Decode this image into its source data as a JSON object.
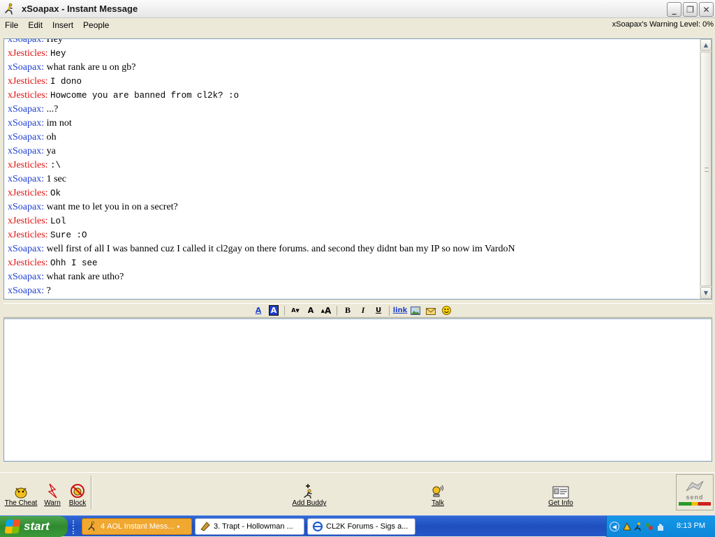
{
  "window": {
    "title": "xSoapax - Instant Message",
    "controls": {
      "minimize": "_",
      "restore": "❐",
      "close": "✕"
    }
  },
  "menubar": {
    "items": [
      "File",
      "Edit",
      "Insert",
      "People"
    ],
    "warning_level": "xSoapax's Warning Level: 0%"
  },
  "conversation": [
    {
      "sn": "xSoapax",
      "color": "blue",
      "text": "Hey"
    },
    {
      "sn": "xJesticles",
      "color": "red",
      "text": "Hey"
    },
    {
      "sn": "xSoapax",
      "color": "blue",
      "text": "what rank are u on gb?"
    },
    {
      "sn": "xJesticles",
      "color": "red",
      "text": "I dono"
    },
    {
      "sn": "xJesticles",
      "color": "red",
      "text": "Howcome you are banned from cl2k? :o"
    },
    {
      "sn": "xSoapax",
      "color": "blue",
      "text": "...?"
    },
    {
      "sn": "xSoapax",
      "color": "blue",
      "text": "im not"
    },
    {
      "sn": "xSoapax",
      "color": "blue",
      "text": "oh"
    },
    {
      "sn": "xSoapax",
      "color": "blue",
      "text": "ya"
    },
    {
      "sn": "xJesticles",
      "color": "red",
      "text": ":\\"
    },
    {
      "sn": "xSoapax",
      "color": "blue",
      "text": "1 sec"
    },
    {
      "sn": "xJesticles",
      "color": "red",
      "text": "Ok"
    },
    {
      "sn": "xSoapax",
      "color": "blue",
      "text": "want me to let you in on a secret?"
    },
    {
      "sn": "xJesticles",
      "color": "red",
      "text": "Lol"
    },
    {
      "sn": "xJesticles",
      "color": "red",
      "text": "Sure :O"
    },
    {
      "sn": "xSoapax",
      "color": "blue",
      "text": "well first of all I was banned cuz I called it cl2gay on there forums. and second they didnt ban my IP so now im VardoN"
    },
    {
      "sn": "xJesticles",
      "color": "red",
      "text": "Ohh I see"
    },
    {
      "sn": "xSoapax",
      "color": "blue",
      "text": "what  rank are utho?"
    },
    {
      "sn": "xSoapax",
      "color": "blue",
      "text": "?"
    }
  ],
  "format_toolbar": {
    "text_color": "A",
    "back_color": "A",
    "decrease_font": "A",
    "normal_font": "A",
    "increase_font": "A",
    "bold": "B",
    "italic": "I",
    "underline": "U",
    "link": "link"
  },
  "actions": {
    "the_cheat": "The Cheat",
    "warn": "Warn",
    "block": "Block",
    "add_buddy": "Add Buddy",
    "talk": "Talk",
    "get_info": "Get Info",
    "send": "send"
  },
  "taskbar": {
    "start": "start",
    "tasks": [
      {
        "label": "AOL Instant Mess...",
        "count": "4"
      },
      {
        "label": "3. Trapt - Hollowman ..."
      },
      {
        "label": "CL2K Forums - Sigs a..."
      }
    ],
    "clock": "8:13 PM"
  },
  "colors": {
    "screenname_blue": "#1f3fd0",
    "screenname_red": "#e01010",
    "taskbar": "#2457c8",
    "start": "#3a9a3a"
  }
}
